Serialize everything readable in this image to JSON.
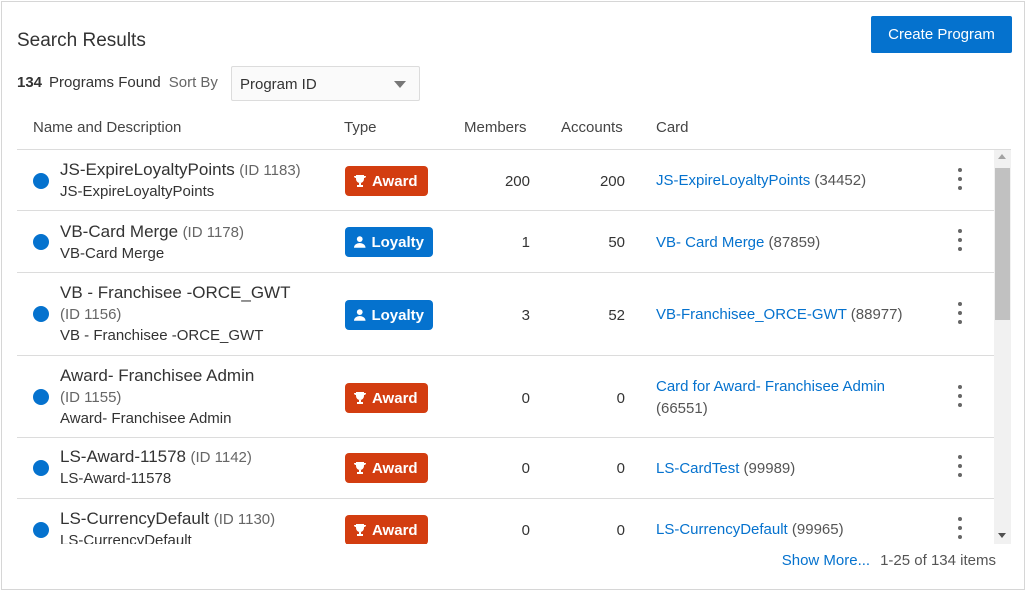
{
  "header": {
    "title": "Search Results",
    "create_button": "Create Program"
  },
  "summary": {
    "count": "134",
    "found_label": "Programs Found",
    "sort_label": "Sort By",
    "sort_value": "Program ID"
  },
  "columns": {
    "name": "Name and Description",
    "type": "Type",
    "members": "Members",
    "accounts": "Accounts",
    "card": "Card"
  },
  "rows": [
    {
      "name": "JS-ExpireLoyaltyPoints",
      "id": "(ID 1183)",
      "desc": "JS-ExpireLoyaltyPoints",
      "type": "Award",
      "members": "200",
      "accounts": "200",
      "card_name": "JS-ExpireLoyaltyPoints",
      "card_id": "(34452)"
    },
    {
      "name": "VB-Card Merge",
      "id": "(ID 1178)",
      "desc": "VB-Card Merge",
      "type": "Loyalty",
      "members": "1",
      "accounts": "50",
      "card_name": "VB- Card Merge",
      "card_id": "(87859)"
    },
    {
      "name": "VB - Franchisee -ORCE_GWT",
      "id": "(ID 1156)",
      "desc": "VB - Franchisee -ORCE_GWT",
      "type": "Loyalty",
      "members": "3",
      "accounts": "52",
      "card_name": "VB-Franchisee_ORCE-GWT",
      "card_id": "(88977)"
    },
    {
      "name": "Award- Franchisee Admin",
      "id": "(ID 1155)",
      "desc": "Award- Franchisee Admin",
      "type": "Award",
      "members": "0",
      "accounts": "0",
      "card_name": "Card for Award- Franchisee Admin",
      "card_id": "(66551)"
    },
    {
      "name": "LS-Award-11578",
      "id": "(ID 1142)",
      "desc": "LS-Award-11578",
      "type": "Award",
      "members": "0",
      "accounts": "0",
      "card_name": "LS-CardTest",
      "card_id": "(99989)"
    },
    {
      "name": "LS-CurrencyDefault",
      "id": "(ID 1130)",
      "desc": "LS-CurrencyDefault",
      "type": "Award",
      "members": "0",
      "accounts": "0",
      "card_name": "LS-CurrencyDefault",
      "card_id": "(99965)"
    }
  ],
  "footer": {
    "show_more": "Show More...",
    "pagination": "1-25 of 134 items"
  },
  "colors": {
    "accent": "#0572ce",
    "award": "#d33d10",
    "status_dot": "#0572ce"
  }
}
